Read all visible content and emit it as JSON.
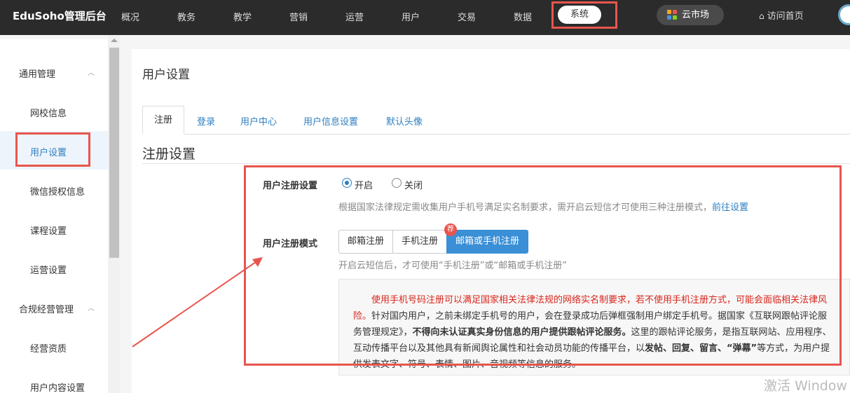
{
  "topbar": {
    "brand": "EduSoho管理后台",
    "nav": [
      "概况",
      "教务",
      "教学",
      "营销",
      "运营",
      "用户",
      "交易",
      "数据"
    ],
    "active_nav": "系统",
    "market_label": "云市场",
    "visit_label": "访问首页"
  },
  "sidebar": {
    "group1": "通用管理",
    "items1": [
      "网校信息",
      "用户设置",
      "微信授权信息",
      "课程设置",
      "运营设置"
    ],
    "group2": "合规经营管理",
    "items2": [
      "经营资质",
      "用户内容设置"
    ]
  },
  "page": {
    "title": "用户设置",
    "tabs": [
      "注册",
      "登录",
      "用户中心",
      "用户信息设置",
      "默认头像"
    ],
    "section_title": "注册设置"
  },
  "form": {
    "register_setting_label": "用户注册设置",
    "opt_on": "开启",
    "opt_off": "关闭",
    "register_help": "根据国家法律规定需收集用户手机号满足实名制要求，需开启云短信才可使用三种注册模式，",
    "register_help_link": "前往设置",
    "mode_label": "用户注册模式",
    "modes": [
      "邮箱注册",
      "手机注册",
      "邮箱或手机注册"
    ],
    "rec_badge": "荐",
    "mode_help": "开启云短信后，才可使用“手机注册”或“邮箱或手机注册”",
    "notice_red": "使用手机号码注册可以满足国家相关法律法规的网络实名制要求，若不使用手机注册方式，可能会面临相关法律风险。",
    "notice_p1": "针对国内用户，之前未绑定手机号的用户，会在登录成功后弹框强制用户绑定手机号。据国家《互联网跟帖评论服务管理规定》，",
    "notice_b1": "不得向未认证真实身份信息的用户提供跟帖评论服务。",
    "notice_p2": "这里的跟帖评论服务，是指互联网站、应用程序、互动传播平台以及其他具有新闻舆论属性和社会动员功能的传播平台，以",
    "notice_b2": "发帖、回复、留言、“弹幕”",
    "notice_p3": "等方式，为用户提供发表文字、符号、表情、图片、音视频等信息的服务。"
  },
  "watermark": "激活 Window",
  "colors": {
    "accent": "#2d7fc1",
    "highlight": "#e8554e",
    "topbar": "#2b2b2b"
  }
}
